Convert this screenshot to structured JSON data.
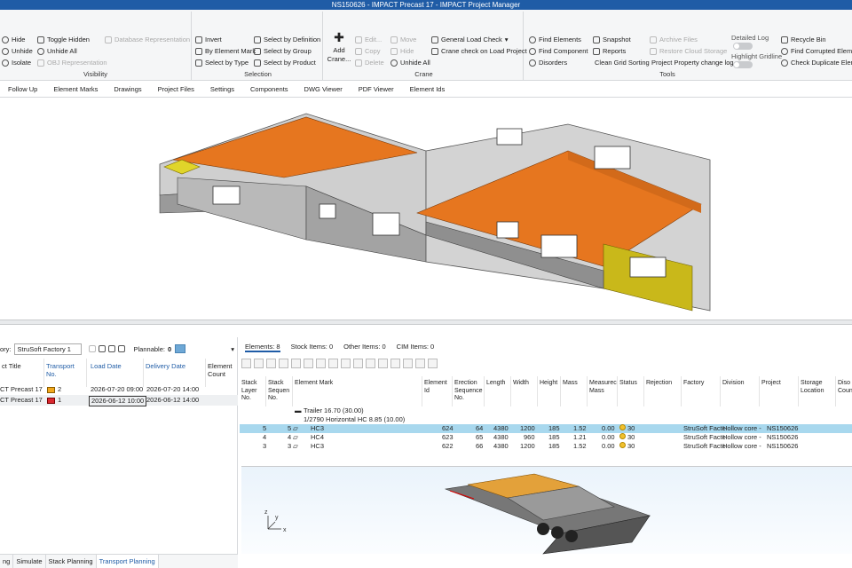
{
  "window": {
    "title": "NS150626 - IMPACT Precast 17 - IMPACT Project Manager"
  },
  "ribbon": {
    "visibility": {
      "title": "Visibility",
      "hide": "Hide",
      "unhide": "Unhide",
      "isolate": "Isolate",
      "toggle_hidden": "Toggle Hidden",
      "unhide_all": "Unhide All",
      "obj_repr": "OBJ Representation",
      "db_repr": "Database Representation"
    },
    "selection": {
      "title": "Selection",
      "invert": "Invert",
      "by_element_mark": "By Element Mark",
      "select_by_type": "Select by Type",
      "by_definition": "Select by Definition",
      "by_group": "Select by Group",
      "by_product": "Select by Product"
    },
    "crane": {
      "title": "Crane",
      "add_crane": "Add Crane...",
      "edit": "Edit...",
      "copy": "Copy",
      "delete": "Delete",
      "move": "Move",
      "hide": "Hide",
      "unhide_all": "Unhide All",
      "general_load_check": "General Load Check",
      "crane_check": "Crane check on Load Project"
    },
    "tools": {
      "title": "Tools",
      "find_elements": "Find Elements",
      "find_component": "Find Component",
      "disorders": "Disorders",
      "snapshot": "Snapshot",
      "reports": "Reports",
      "clean_grid": "Clean Grid Sorting",
      "archive_files": "Archive Files",
      "restore_cloud": "Restore Cloud Storage",
      "project_property": "Project Property change log",
      "detailed_log": "Detailed Log",
      "highlight_gridline": "Highlight Gridline",
      "recycle_bin": "Recycle Bin",
      "find_corrupted": "Find Corrupted Elemen",
      "check_duplicate": "Check Duplicate Eleme"
    }
  },
  "tabs": [
    "Follow Up",
    "Element Marks",
    "Drawings",
    "Project Files",
    "Settings",
    "Components",
    "DWG Viewer",
    "PDF Viewer",
    "Element Ids"
  ],
  "left": {
    "factory_label": "ory:",
    "factory_value": "StruSoft Factory 1",
    "plannable_label": "Plannable:",
    "plannable_value": "0",
    "headers": {
      "title": "ct Title",
      "transport_no": "Transport No.",
      "load_date": "Load Date",
      "delivery_date": "Delivery Date",
      "element_count": "Element Count"
    },
    "rows": [
      {
        "title": "CT Precast 17",
        "transport_no": "2",
        "load_date": "2026-07-20 09:00",
        "delivery_date": "2026-07-20 14:00",
        "color": "#f2a81d"
      },
      {
        "title": "CT Precast 17",
        "transport_no": "1",
        "load_date": "2026-06-12 10:00",
        "delivery_date": "2026-06-12 14:00",
        "color": "#d9282f"
      }
    ]
  },
  "right": {
    "tabs": {
      "elements": "Elements: 8",
      "stock": "Stock Items: 0",
      "other": "Other Items: 0",
      "cim": "CIM Items: 0"
    },
    "headers": [
      "Stack Layer No.",
      "Stack Sequen No.",
      "Element Mark",
      "Element Id",
      "Erection Sequence No.",
      "Length",
      "Width",
      "Height",
      "Mass",
      "Measurec Mass",
      "Status",
      "Rejection",
      "Factory",
      "Division",
      "Project",
      "Storage Location",
      "Diso Coun"
    ],
    "group1": "Trailer 16.70 (30.00)",
    "group2": "1/2790 Horizontal HC 8.85 (10.00)",
    "rows": [
      {
        "layer": "5",
        "seq": "5",
        "mark": "HC3",
        "id": "624",
        "erect": "64",
        "length": "4380",
        "width": "1200",
        "height": "185",
        "mass": "1.52",
        "mmass": "0.00",
        "status": "30",
        "factory": "StruSoft Factc",
        "division": "Hollow core -",
        "project": "NS150626"
      },
      {
        "layer": "4",
        "seq": "4",
        "mark": "HC4",
        "id": "623",
        "erect": "65",
        "length": "4380",
        "width": "960",
        "height": "185",
        "mass": "1.21",
        "mmass": "0.00",
        "status": "30",
        "factory": "StruSoft Factc",
        "division": "Hollow core -",
        "project": "NS150626"
      },
      {
        "layer": "3",
        "seq": "3",
        "mark": "HC3",
        "id": "622",
        "erect": "66",
        "length": "4380",
        "width": "1200",
        "height": "185",
        "mass": "1.52",
        "mmass": "0.00",
        "status": "30",
        "factory": "StruSoft Factc",
        "division": "Hollow core -",
        "project": "NS150626"
      }
    ]
  },
  "status_tabs": [
    "ng",
    "Simulate",
    "Stack Planning",
    "Transport Planning"
  ]
}
